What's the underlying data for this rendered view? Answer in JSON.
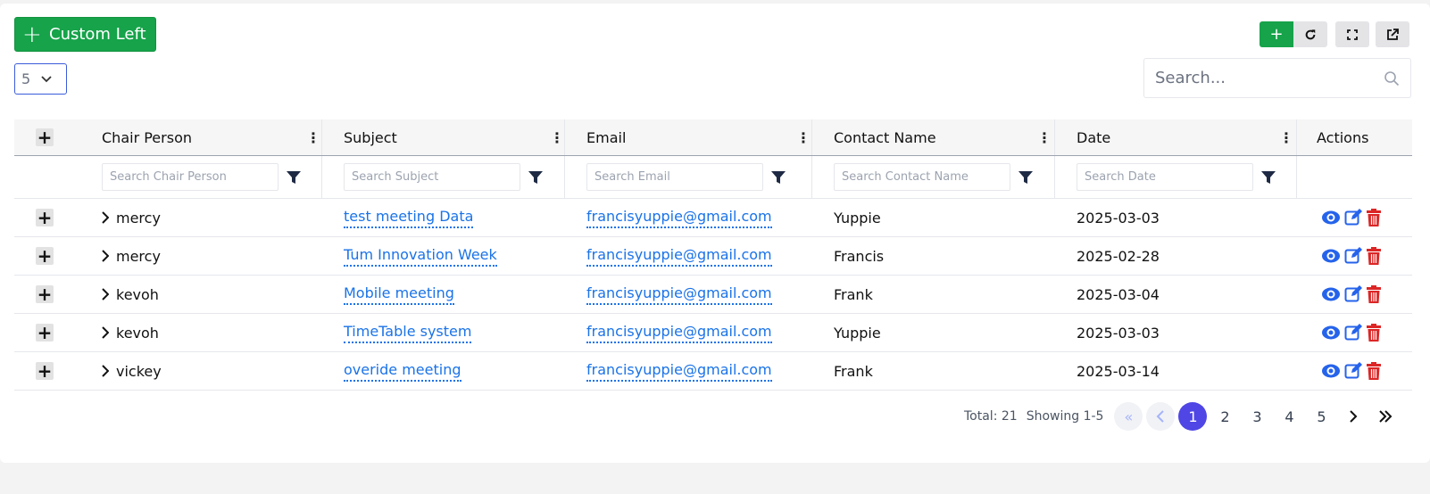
{
  "toolbar": {
    "custom_left_label": "Custom Left",
    "page_size": "5",
    "search_placeholder": "Search..."
  },
  "columns": [
    {
      "label": "Chair Person",
      "filter_placeholder": "Search Chair Person"
    },
    {
      "label": "Subject",
      "filter_placeholder": "Search Subject"
    },
    {
      "label": "Email",
      "filter_placeholder": "Search Email"
    },
    {
      "label": "Contact Name",
      "filter_placeholder": "Search Contact Name"
    },
    {
      "label": "Date",
      "filter_placeholder": "Search Date"
    },
    {
      "label": "Actions"
    }
  ],
  "rows": [
    {
      "chair": "mercy",
      "subject": "test meeting Data",
      "email": "francisyuppie@gmail.com",
      "contact": "Yuppie",
      "date": "2025-03-03"
    },
    {
      "chair": "mercy",
      "subject": "Tum Innovation Week",
      "email": "francisyuppie@gmail.com",
      "contact": "Francis",
      "date": "2025-02-28"
    },
    {
      "chair": "kevoh",
      "subject": "Mobile meeting",
      "email": "francisyuppie@gmail.com",
      "contact": "Frank",
      "date": "2025-03-04"
    },
    {
      "chair": "kevoh",
      "subject": "TimeTable system",
      "email": "francisyuppie@gmail.com",
      "contact": "Yuppie",
      "date": "2025-03-03"
    },
    {
      "chair": "vickey",
      "subject": "overide meeting",
      "email": "francisyuppie@gmail.com",
      "contact": "Frank",
      "date": "2025-03-14"
    }
  ],
  "pagination": {
    "total_label": "Total: 21",
    "showing_label": "Showing 1-5",
    "pages": [
      "1",
      "2",
      "3",
      "4",
      "5"
    ],
    "current_page": "1"
  },
  "colors": {
    "primary_green": "#16a34a",
    "link_blue": "#1a73e8",
    "view_icon": "#2563eb",
    "delete_icon": "#dc2626",
    "active_page": "#4f46e5"
  }
}
